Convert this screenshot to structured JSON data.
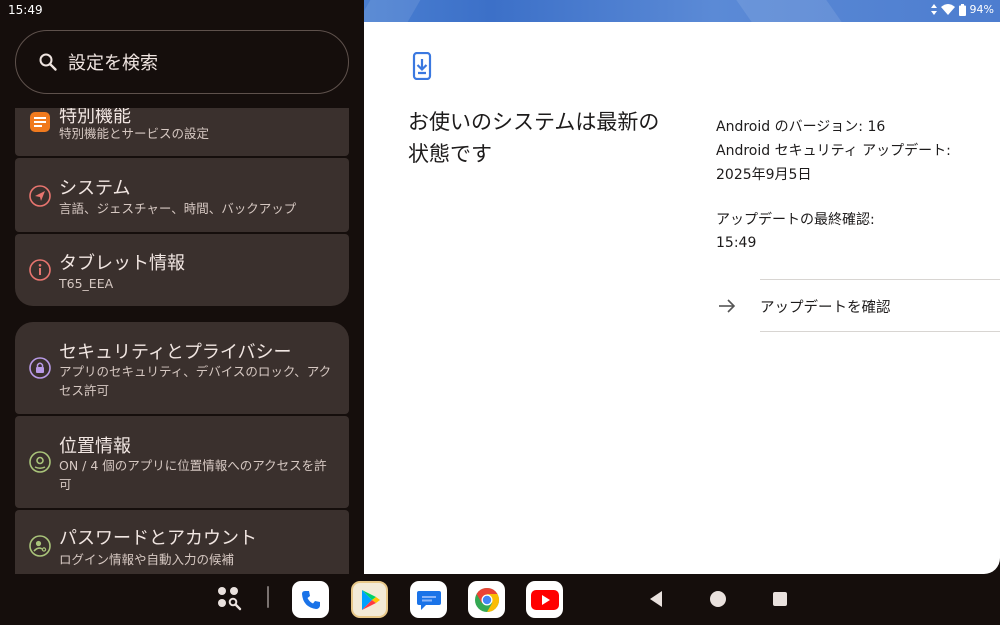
{
  "status_bar": {
    "time": "15:49",
    "battery_percent": "94%",
    "icons": [
      "data-transfer-icon",
      "wifi-icon",
      "battery-icon"
    ]
  },
  "search": {
    "placeholder": "設定を検索"
  },
  "settings_list": [
    {
      "title": "特別機能",
      "subtitle": "特別機能とサービスの設定",
      "icon": "accessibility-icon",
      "color": "#f07a1e"
    },
    {
      "title": "システム",
      "subtitle": "言語、ジェスチャー、時間、バックアップ",
      "icon": "system-icon",
      "color": "#e8756f"
    },
    {
      "title": "タブレット情報",
      "subtitle": "T65_EEA",
      "icon": "info-icon",
      "color": "#e8756f"
    },
    {
      "title": "セキュリティとプライバシー",
      "subtitle": "アプリのセキュリティ、デバイスのロック、アクセス許可",
      "icon": "lock-icon",
      "color": "#b89ae6"
    },
    {
      "title": "位置情報",
      "subtitle": "ON / 4 個のアプリに位置情報へのアクセスを許可",
      "icon": "location-icon",
      "color": "#a9c47a"
    },
    {
      "title": "パスワードとアカウント",
      "subtitle": "ログイン情報や自動入力の候補",
      "icon": "account-key-icon",
      "color": "#a9c47a"
    }
  ],
  "detail": {
    "headline": "お使いのシステムは最新の状態です",
    "android_version": "Android のバージョン: 16",
    "security_update_label": "Android セキュリティ アップデート:",
    "security_update_date": "2025年9月5日",
    "last_check_label": "アップデートの最終確認:",
    "last_check_time": "15:49",
    "check_button": "アップデートを確認"
  },
  "taskbar": {
    "apps": [
      "app-drawer-icon",
      "phone-app-icon",
      "play-store-app-icon",
      "messages-app-icon",
      "chrome-app-icon",
      "youtube-app-icon"
    ],
    "nav": [
      "back-button",
      "home-button",
      "recents-button"
    ]
  },
  "colors": {
    "background": "#150e0c",
    "card": "#3a302d",
    "accent_blue": "#4a7fd1",
    "detail_bg": "#ffffff"
  }
}
